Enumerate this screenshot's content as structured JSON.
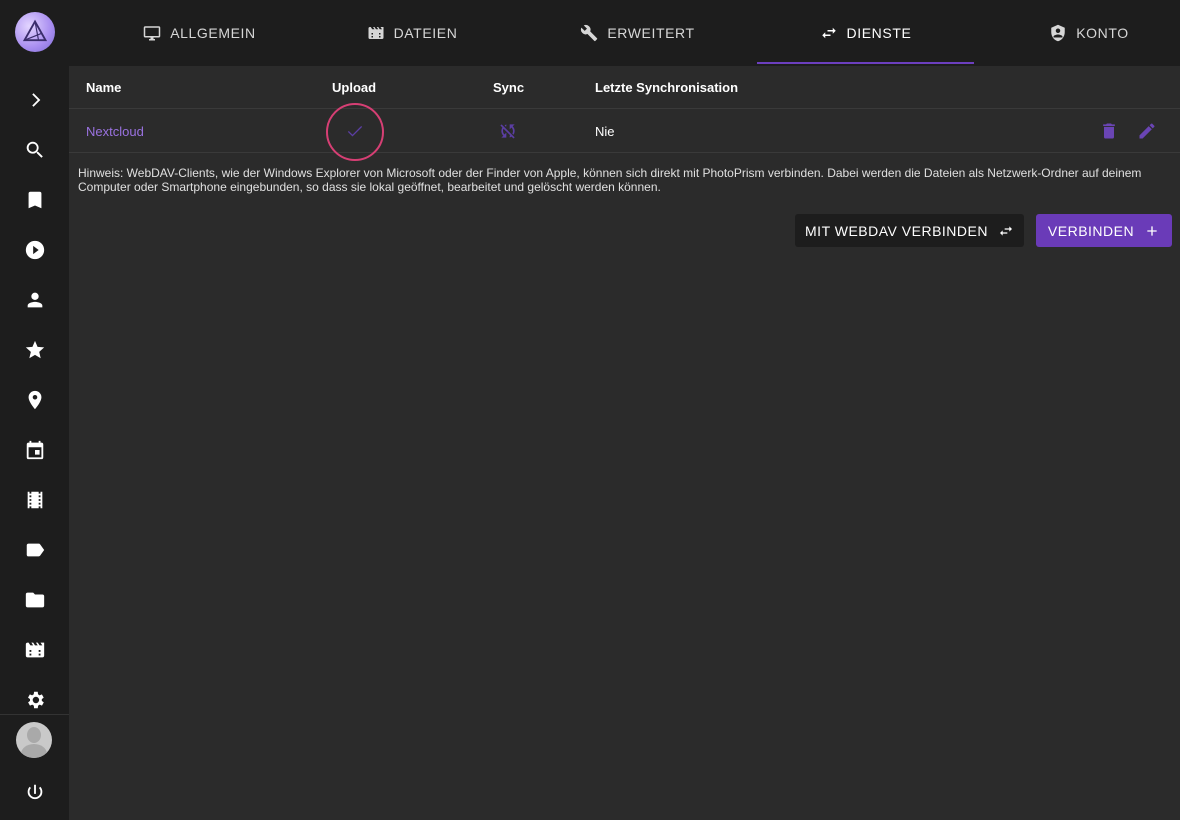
{
  "tabs": [
    {
      "label": "ALLGEMEIN",
      "icon": "monitor-icon"
    },
    {
      "label": "DATEIEN",
      "icon": "film-folder-icon"
    },
    {
      "label": "ERWEITERT",
      "icon": "wrench-icon"
    },
    {
      "label": "DIENSTE",
      "icon": "swap-icon",
      "active": true
    },
    {
      "label": "KONTO",
      "icon": "account-shield-icon"
    }
  ],
  "sidebar": {
    "items": [
      {
        "icon": "chevron-right-icon"
      },
      {
        "icon": "search-icon"
      },
      {
        "icon": "bookmark-icon"
      },
      {
        "icon": "play-circle-icon"
      },
      {
        "icon": "person-icon"
      },
      {
        "icon": "star-icon"
      },
      {
        "icon": "place-icon"
      },
      {
        "icon": "calendar-icon"
      },
      {
        "icon": "film-icon"
      },
      {
        "icon": "label-icon"
      },
      {
        "icon": "folder-icon"
      },
      {
        "icon": "film-folder-icon"
      },
      {
        "icon": "gear-icon"
      },
      {
        "icon": "power-icon"
      }
    ]
  },
  "table": {
    "headers": {
      "name": "Name",
      "upload": "Upload",
      "sync": "Sync",
      "last_sync": "Letzte Synchronisation"
    },
    "rows": [
      {
        "name": "Nextcloud",
        "upload": "check-icon",
        "sync": "sync-off-icon",
        "last_sync": "Nie"
      }
    ]
  },
  "hint": "Hinweis: WebDAV-Clients, wie der Windows Explorer von Microsoft oder der Finder von Apple, können sich direkt mit PhotoPrism verbinden. Dabei werden die Dateien als Netzwerk-Ordner auf deinem Computer oder Smartphone eingebunden, so dass sie lokal geöffnet, bearbeitet und gelöscht werden können.",
  "buttons": {
    "webdav": "MIT WEBDAV VERBINDEN",
    "connect": "VERBINDEN"
  },
  "colors": {
    "accent": "#6a3bb8",
    "sidebar_bg": "#1d1d1d",
    "content_bg": "#2b2b2b",
    "highlight": "#d63f74"
  }
}
